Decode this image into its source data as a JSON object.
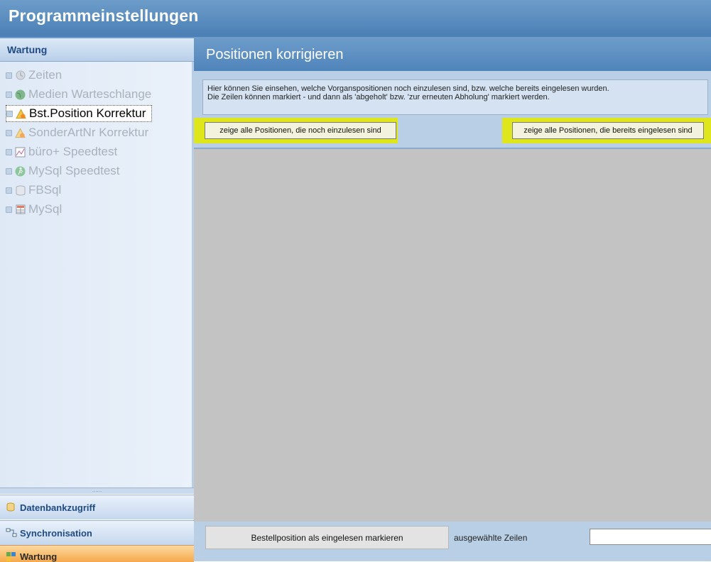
{
  "window": {
    "title": "Programmeinstellungen"
  },
  "sidebar": {
    "header": "Wartung",
    "items": [
      {
        "label": "Zeiten",
        "icon": "clock-icon",
        "selected": false
      },
      {
        "label": "Medien Warteschlange",
        "icon": "globe-icon",
        "selected": false
      },
      {
        "label": "Bst.Position Korrektur",
        "icon": "warning-icon",
        "selected": true
      },
      {
        "label": "SonderArtNr Korrektur",
        "icon": "warning-icon",
        "selected": false
      },
      {
        "label": "büro+ Speedtest",
        "icon": "chart-icon",
        "selected": false
      },
      {
        "label": "MySql Speedtest",
        "icon": "runner-icon",
        "selected": false
      },
      {
        "label": "FBSql",
        "icon": "database-icon",
        "selected": false
      },
      {
        "label": "MySql",
        "icon": "table-icon",
        "selected": false
      }
    ],
    "splitter_dots": "......",
    "groups": [
      {
        "label": "Datenbankzugriff",
        "icon": "database-key-icon"
      },
      {
        "label": "Synchronisation",
        "icon": "sync-icon"
      },
      {
        "label": "Wartung",
        "icon": "wartung-icon"
      }
    ]
  },
  "content": {
    "title": "Positionen korrigieren",
    "info_line1": "Hier können Sie einsehen, welche Vorganspositionen noch einzulesen sind, bzw. welche bereits eingelesen wurden.",
    "info_line2": "Die Zeilen können markiert - und dann als 'abgeholt' bzw. 'zur erneuten Abholung' markiert werden.",
    "btn_pending": "zeige alle Positionen, die noch einzulesen sind",
    "btn_read": "zeige alle Positionen, die bereits eingelesen sind",
    "mark_button": "Bestellposition als eingelesen markieren",
    "selected_rows_label": "ausgewählte Zeilen",
    "selected_rows_value": ""
  },
  "colors": {
    "title_bar": "#4a7fb5",
    "highlight": "#e0e61c",
    "grid_background": "#c3c3c3",
    "active_group": "#f6a94a"
  }
}
